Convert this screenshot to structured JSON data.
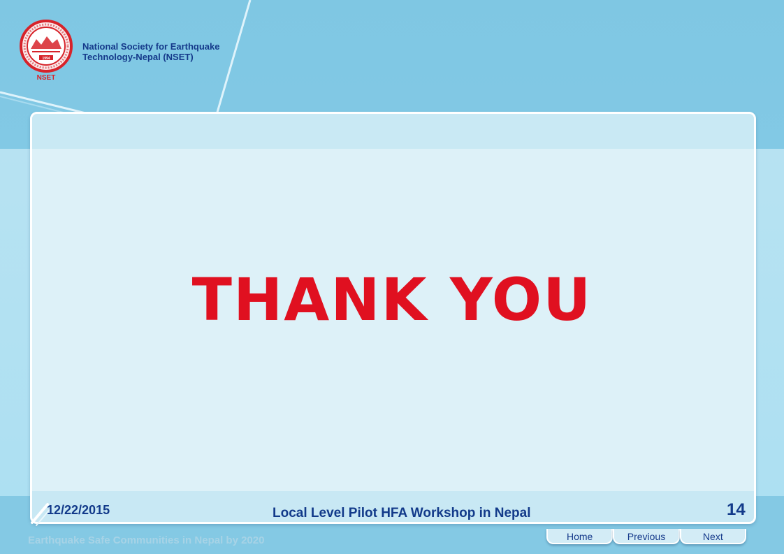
{
  "organization": {
    "name_line1": "National Society for Earthquake",
    "name_line2": "Technology-Nepal (NSET)",
    "logo_label": "NSET",
    "logo_year": "1994"
  },
  "slide": {
    "heading": "THANK YOU",
    "date": "12/22/2015",
    "footer_title": "Local Level Pilot HFA Workshop in Nepal",
    "page_number": "14",
    "tagline": "Earthquake Safe Communities in Nepal by 2020"
  },
  "nav": {
    "home_label": "Home",
    "previous_label": "Previous",
    "next_label": "Next"
  },
  "colors": {
    "heading": "#e01020",
    "text": "#123a8a",
    "background_top": "#7fc7e3",
    "panel": "#ddf1f8"
  }
}
